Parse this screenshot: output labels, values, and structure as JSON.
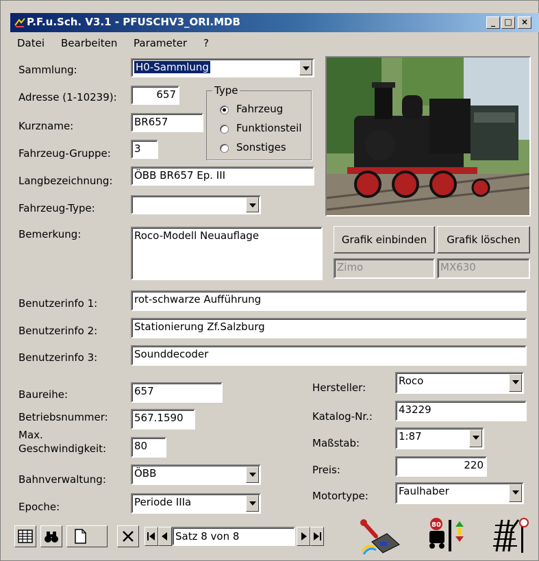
{
  "window": {
    "title": "P.F.u.Sch. V3.1 - PFUSCHV3_ORI.MDB",
    "minimize": "_",
    "maximize": "□",
    "close": "×"
  },
  "menu": [
    "Datei",
    "Bearbeiten",
    "Parameter",
    "?"
  ],
  "left": {
    "sammlung_label": "Sammlung:",
    "sammlung_value": "H0-Sammlung",
    "adresse_label": "Adresse (1-10239):",
    "adresse_value": "657",
    "kurzname_label": "Kurzname:",
    "kurzname_value": "BR657",
    "gruppe_label": "Fahrzeug-Gruppe:",
    "gruppe_value": "3",
    "lang_label": "Langbezeichnung:",
    "lang_value": "ÖBB BR657 Ep. III",
    "type_label": "Fahrzeug-Type:",
    "type_value": "",
    "bemerkung_label": "Bemerkung:",
    "bemerkung_value": "Roco-Modell Neuauflage"
  },
  "type_group": {
    "title": "Type",
    "options": [
      "Fahrzeug",
      "Funktionsteil",
      "Sonstiges"
    ],
    "selected": "Fahrzeug"
  },
  "graphic": {
    "bind_label": "Grafik einbinden",
    "delete_label": "Grafik löschen",
    "decoder_maker": "Zimo",
    "decoder_model": "MX630"
  },
  "userinfo": [
    {
      "label": "Benutzerinfo 1:",
      "value": "rot-schwarze Aufführung"
    },
    {
      "label": "Benutzerinfo 2:",
      "value": "Stationierung Zf.Salzburg"
    },
    {
      "label": "Benutzerinfo 3:",
      "value": "Sounddecoder"
    }
  ],
  "details": {
    "baureihe_label": "Baureihe:",
    "baureihe_value": "657",
    "betriebsnr_label": "Betriebsnummer:",
    "betriebsnr_value": "567.1590",
    "maxv_label_1": "Max.",
    "maxv_label_2": "Geschwindigkeit:",
    "maxv_value": "80",
    "bahnverwaltung_label": "Bahnverwaltung:",
    "bahnverwaltung_value": "ÖBB",
    "epoche_label": "Epoche:",
    "epoche_value": "Periode IIIa",
    "hersteller_label": "Hersteller:",
    "hersteller_value": "Roco",
    "katalog_label": "Katalog-Nr.:",
    "katalog_value": "43229",
    "massstab_label": "Maßstab:",
    "massstab_value": "1:87",
    "preis_label": "Preis:",
    "preis_value": "220",
    "motortype_label": "Motortype:",
    "motortype_value": "Faulhaber"
  },
  "navigator": {
    "record_text": "Satz 8 von 8"
  },
  "icons": [
    "table-icon",
    "binoculars-icon",
    "new-record-icon",
    "delete-record-icon",
    "first-record-icon",
    "prev-record-icon",
    "next-record-icon",
    "last-record-icon",
    "control-panel-icon",
    "loco-speed-icon",
    "track-switch-icon"
  ]
}
